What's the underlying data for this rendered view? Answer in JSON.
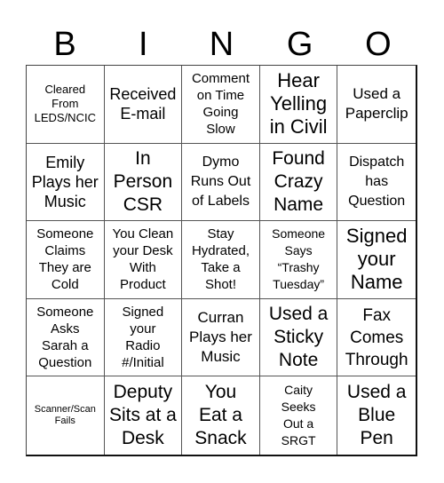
{
  "card": {
    "header_letters": [
      "B",
      "I",
      "N",
      "G",
      "O"
    ],
    "cells": [
      "Cleared From LEDS/NCIC",
      "Received E-mail",
      "Comment on Time Going Slow",
      "Hear Yelling in Civil",
      "Used a Paperclip",
      "Emily Plays her Music",
      "In Person CSR",
      "Dymo Runs Out of Labels",
      "Found Crazy Name",
      "Dispatch has Question",
      "Someone Claims They are Cold",
      "You Clean your Desk With Product",
      "Stay Hydrated, Take a Shot!",
      "Someone Says “Trashy Tuesday”",
      "Signed your Name",
      "Someone Asks Sarah a Question",
      "Signed your Radio #/Initial",
      "Curran Plays her Music",
      "Used a Sticky Note",
      "Fax Comes Through",
      "Scanner/Scan Fails",
      "Deputy Sits at a Desk",
      "You Eat a Snack",
      "Caity Seeks Out a SRGT",
      "Used a Blue Pen"
    ]
  }
}
